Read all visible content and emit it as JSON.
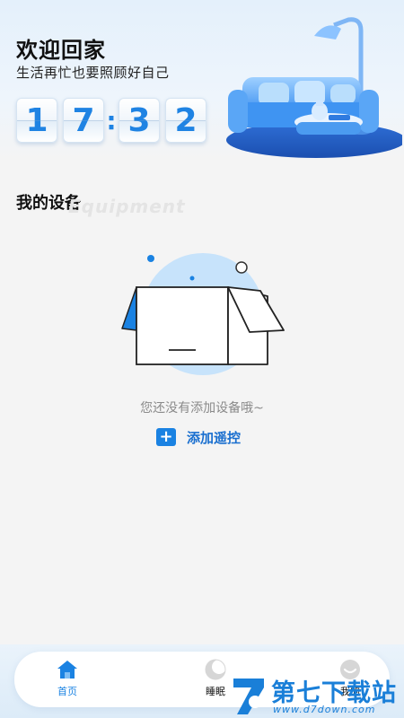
{
  "header": {
    "title": "欢迎回家",
    "subtitle": "生活再忙也要照顾好自己",
    "clock": {
      "h1": "1",
      "h2": "7",
      "m1": "3",
      "m2": "2"
    }
  },
  "devices": {
    "section_title": "我的设备",
    "section_watermark": "Equipment",
    "empty_text": "您还没有添加设备哦~",
    "add_button_label": "添加遥控"
  },
  "tabbar": {
    "tabs": [
      {
        "label": "首页",
        "icon": "home-icon",
        "active": true
      },
      {
        "label": "睡眠",
        "icon": "moon-icon",
        "active": false
      },
      {
        "label": "我的",
        "icon": "profile-icon",
        "active": false
      }
    ]
  },
  "watermark": {
    "brand": "第七下载站",
    "url": "www.d7down.com"
  },
  "colors": {
    "accent": "#1a82e2",
    "background": "#f4f4f4",
    "header_gradient_top": "#e4f0fb"
  }
}
